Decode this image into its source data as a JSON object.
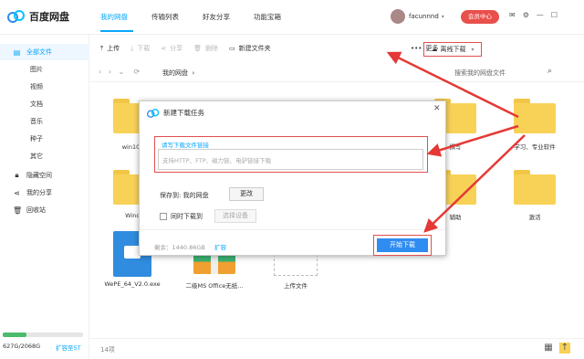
{
  "app": {
    "title": "百度网盘"
  },
  "nav": {
    "tabs": [
      "我的网盘",
      "传输列表",
      "好友分享",
      "功能宝箱"
    ]
  },
  "user": {
    "name": "facunnnd",
    "vip_label": "会员中心"
  },
  "sidebar": {
    "items": [
      {
        "label": "全部文件",
        "icon": "file-icon"
      },
      {
        "label": "图片"
      },
      {
        "label": "视频"
      },
      {
        "label": "文档"
      },
      {
        "label": "音乐"
      },
      {
        "label": "种子"
      },
      {
        "label": "其它"
      },
      {
        "label": "隐藏空间",
        "icon": "lock-icon"
      },
      {
        "label": "我的分享",
        "icon": "share-icon"
      },
      {
        "label": "回收站",
        "icon": "trash-icon"
      }
    ],
    "storage_text": "627G/2068G",
    "storage_fraction": 0.3,
    "expand_label": "扩容至5T"
  },
  "toolbar": {
    "upload": "上传",
    "download": "下载",
    "share": "分享",
    "delete": "删除",
    "new_folder": "新建文件夹",
    "offline": "离线下载",
    "more": "更多"
  },
  "pathbar": {
    "path": "我的网盘",
    "search_placeholder": "搜索我的网盘文件"
  },
  "files": {
    "labels": [
      "win10封装",
      "Window",
      "撰写",
      "学习、专业软件",
      "辅助",
      "激活",
      "WePE_64_V2.0.exe",
      "二级MS Office无纸...",
      "上传文件"
    ]
  },
  "footer": {
    "count": "14项"
  },
  "dialog": {
    "title": "新建下载任务",
    "field_label": "请写下载文件链接",
    "placeholder": "支持HTTP、FTP、磁力链、电驴链接下载",
    "save_to": "保存到: 我的网盘",
    "change": "更改",
    "sync_label": "同时下载到",
    "select_device": "选择设备",
    "remaining": "剩余：1440.86GB",
    "expand": "扩容",
    "start": "开始下载"
  },
  "colors": {
    "accent": "#06a7ff",
    "folder": "#f8d257",
    "highlight": "#e05050",
    "vip": "#e8504c"
  }
}
